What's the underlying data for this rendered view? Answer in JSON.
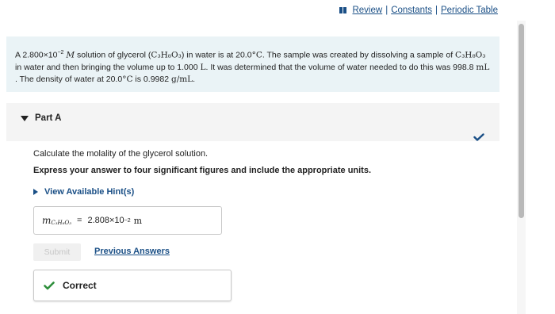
{
  "toplinks": {
    "review": "Review",
    "constants": "Constants",
    "periodic_table": "Periodic Table",
    "separator": "|"
  },
  "problem": {
    "p1": "A 2.800×10",
    "p1_exp": "−2",
    "p1_unit": "M",
    "p2": " solution of glycerol (",
    "formula": "C₃H₈O₃",
    "p3": ") in water is at 20.0",
    "temp_unit": "°C",
    "p4": ". The sample was created by dissolving a sample of ",
    "p5": " in water and then bringing the volume up to 1.000 ",
    "vol_unit": "L",
    "p6": ". It was determined that the volume of water needed to do this was 998.8 ",
    "ml_unit": "mL",
    "p7": " . The density of water at 20.0",
    "p8": " is 0.9982 ",
    "density_unit": "g/mL",
    "end": "."
  },
  "part": {
    "title": "Part A",
    "question": "Calculate the molality of the glycerol solution.",
    "instruction": "Express your answer to four significant figures and include the appropriate units.",
    "hint_link": "View Available Hint(s)"
  },
  "answer": {
    "var": "m",
    "var_sub": "C₃H₈O₃",
    "equals": "=",
    "value": "2.808×10",
    "value_exp": "−2",
    "unit": "m"
  },
  "actions": {
    "submit": "Submit",
    "previous_answers": "Previous Answers"
  },
  "result": {
    "label": "Correct"
  },
  "colors": {
    "link_blue": "#1a4f86",
    "problem_bg": "#eaf3f6",
    "correct_green": "#2f8f3c"
  }
}
